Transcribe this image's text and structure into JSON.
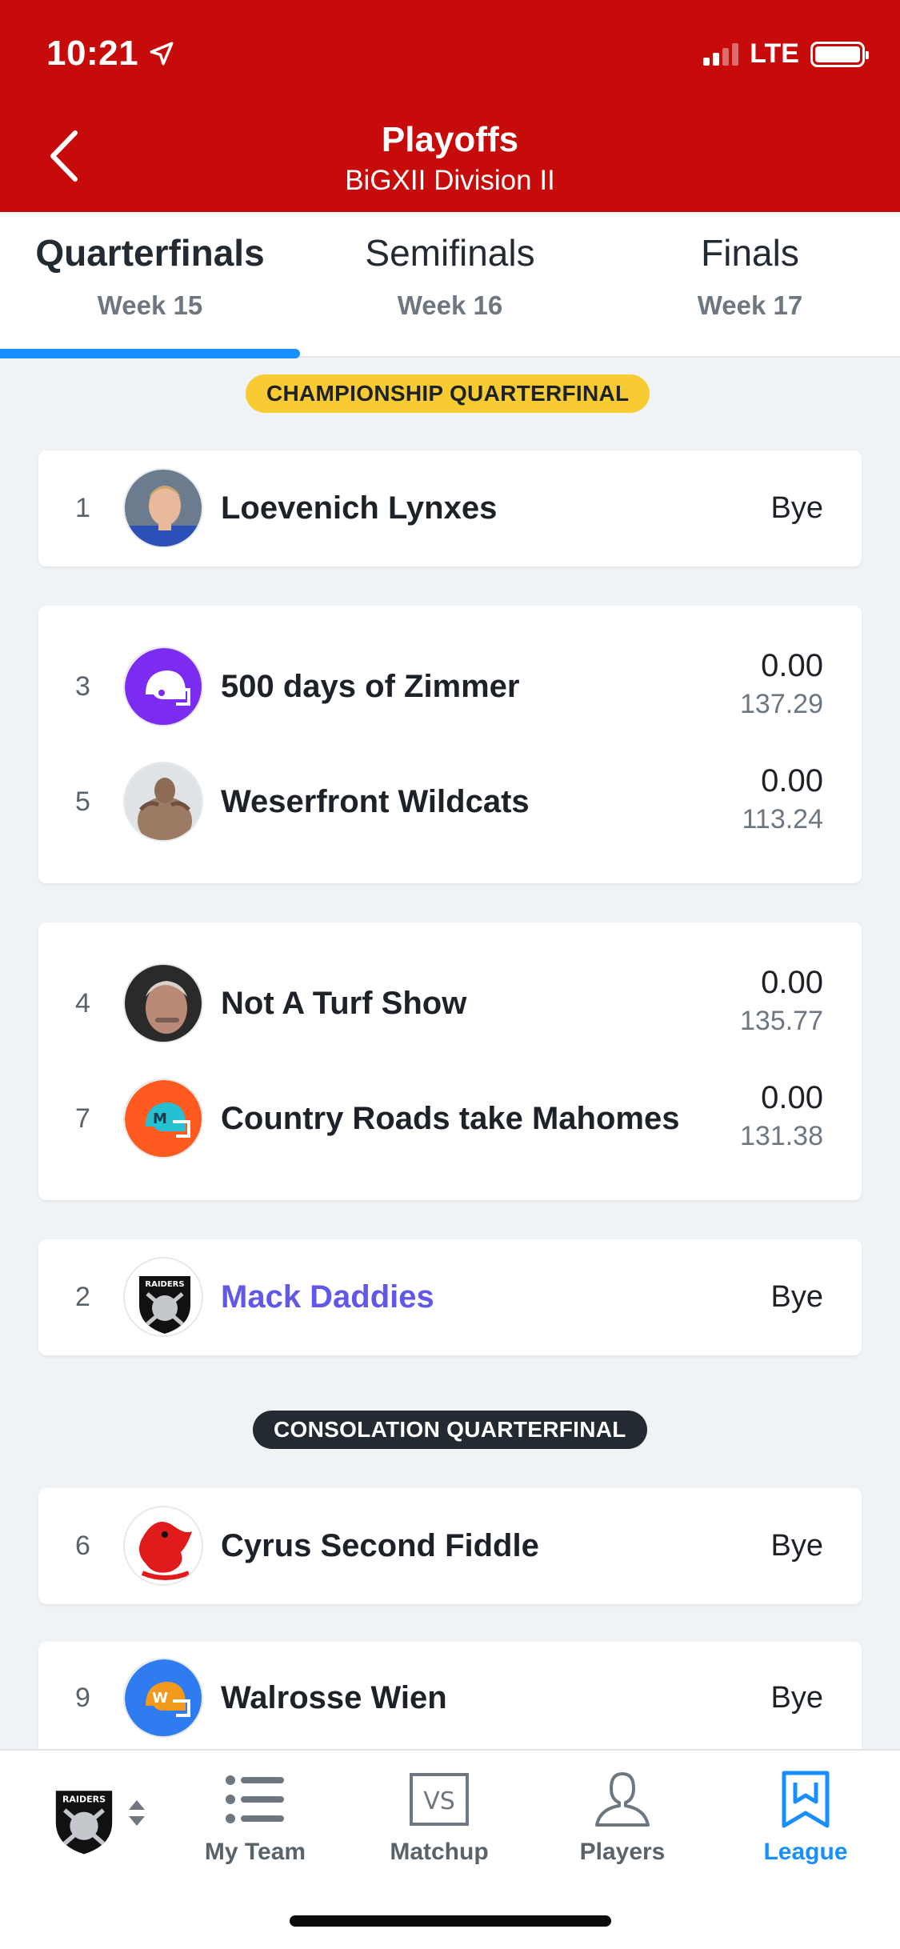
{
  "status": {
    "time": "10:21",
    "network": "LTE"
  },
  "header": {
    "title": "Playoffs",
    "subtitle": "BiGXII Division II"
  },
  "tabs": [
    {
      "label": "Quarterfinals",
      "week": "Week 15",
      "active": true
    },
    {
      "label": "Semifinals",
      "week": "Week 16",
      "active": false
    },
    {
      "label": "Finals",
      "week": "Week 17",
      "active": false
    }
  ],
  "sections": {
    "championship": "CHAMPIONSHIP QUARTERFINAL",
    "consolation": "CONSOLATION QUARTERFINAL"
  },
  "bye_label": "Bye",
  "championship": [
    {
      "seed": "1",
      "team": "Loevenich Lynxes",
      "avatar": "player-photo"
    },
    {
      "seed": "3",
      "team": "500 days of Zimmer",
      "score": "0.00",
      "projected": "137.29",
      "avatar": "purple-helmet"
    },
    {
      "seed": "5",
      "team": "Weserfront Wildcats",
      "score": "0.00",
      "projected": "113.24",
      "avatar": "muscle-photo"
    },
    {
      "seed": "4",
      "team": "Not A Turf Show",
      "score": "0.00",
      "projected": "135.77",
      "avatar": "portrait-photo"
    },
    {
      "seed": "7",
      "team": "Country Roads take Mahomes",
      "score": "0.00",
      "projected": "131.38",
      "avatar": "orange-helmet-M"
    },
    {
      "seed": "2",
      "team": "Mack Daddies",
      "avatar": "raiders-logo",
      "is_user": true
    }
  ],
  "consolation": [
    {
      "seed": "6",
      "team": "Cyrus Second Fiddle",
      "avatar": "cardinal-logo"
    },
    {
      "seed": "9",
      "team": "Walrosse Wien",
      "avatar": "blue-helmet-W"
    }
  ],
  "nav": {
    "team_logo": "RAIDERS",
    "items": [
      {
        "label": "My Team",
        "icon": "list-icon"
      },
      {
        "label": "Matchup",
        "icon": "vs-icon",
        "icon_text": "VS"
      },
      {
        "label": "Players",
        "icon": "person-icon"
      },
      {
        "label": "League",
        "icon": "league-icon",
        "active": true
      }
    ]
  },
  "colors": {
    "header_red": "#c70a0a",
    "accent_blue": "#188fff",
    "user_team": "#6158e8",
    "gold_badge": "#f9cb33"
  }
}
